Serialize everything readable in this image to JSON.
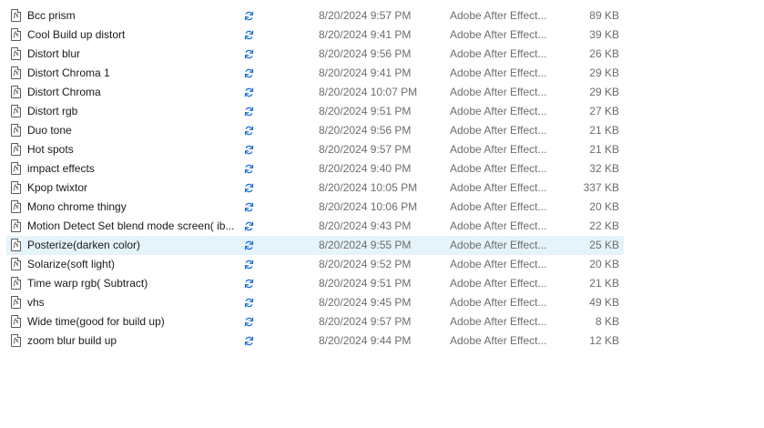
{
  "colors": {
    "selection_bg": "#e5f3fb",
    "sync_icon": "#1e6fd9",
    "meta_text": "#6d6d6d"
  },
  "icons": {
    "file_type": "fx-file-icon",
    "status": "sync-pending-icon"
  },
  "file_icon_glyph": "fx",
  "files": [
    {
      "name": "Bcc prism",
      "date": "8/20/2024 9:57 PM",
      "type": "Adobe After Effect...",
      "size": "89 KB",
      "selected": false
    },
    {
      "name": "Cool Build up distort",
      "date": "8/20/2024 9:41 PM",
      "type": "Adobe After Effect...",
      "size": "39 KB",
      "selected": false
    },
    {
      "name": "Distort blur",
      "date": "8/20/2024 9:56 PM",
      "type": "Adobe After Effect...",
      "size": "26 KB",
      "selected": false
    },
    {
      "name": "Distort Chroma 1",
      "date": "8/20/2024 9:41 PM",
      "type": "Adobe After Effect...",
      "size": "29 KB",
      "selected": false
    },
    {
      "name": "Distort Chroma",
      "date": "8/20/2024 10:07 PM",
      "type": "Adobe After Effect...",
      "size": "29 KB",
      "selected": false
    },
    {
      "name": "Distort rgb",
      "date": "8/20/2024 9:51 PM",
      "type": "Adobe After Effect...",
      "size": "27 KB",
      "selected": false
    },
    {
      "name": "Duo tone",
      "date": "8/20/2024 9:56 PM",
      "type": "Adobe After Effect...",
      "size": "21 KB",
      "selected": false
    },
    {
      "name": "Hot spots",
      "date": "8/20/2024 9:57 PM",
      "type": "Adobe After Effect...",
      "size": "21 KB",
      "selected": false
    },
    {
      "name": "impact effects",
      "date": "8/20/2024 9:40 PM",
      "type": "Adobe After Effect...",
      "size": "32 KB",
      "selected": false
    },
    {
      "name": "Kpop twixtor",
      "date": "8/20/2024 10:05 PM",
      "type": "Adobe After Effect...",
      "size": "337 KB",
      "selected": false
    },
    {
      "name": "Mono  chrome thingy",
      "date": "8/20/2024 10:06 PM",
      "type": "Adobe After Effect...",
      "size": "20 KB",
      "selected": false
    },
    {
      "name": "Motion Detect Set blend mode screen( ib...",
      "date": "8/20/2024 9:43 PM",
      "type": "Adobe After Effect...",
      "size": "22 KB",
      "selected": false
    },
    {
      "name": "Posterize(darken color)",
      "date": "8/20/2024 9:55 PM",
      "type": "Adobe After Effect...",
      "size": "25 KB",
      "selected": true
    },
    {
      "name": "Solarize(soft light)",
      "date": "8/20/2024 9:52 PM",
      "type": "Adobe After Effect...",
      "size": "20 KB",
      "selected": false
    },
    {
      "name": "Time warp rgb( Subtract)",
      "date": "8/20/2024 9:51 PM",
      "type": "Adobe After Effect...",
      "size": "21 KB",
      "selected": false
    },
    {
      "name": "vhs",
      "date": "8/20/2024 9:45 PM",
      "type": "Adobe After Effect...",
      "size": "49 KB",
      "selected": false
    },
    {
      "name": "Wide time(good  for build up)",
      "date": "8/20/2024 9:57 PM",
      "type": "Adobe After Effect...",
      "size": "8 KB",
      "selected": false
    },
    {
      "name": "zoom blur build up",
      "date": "8/20/2024 9:44 PM",
      "type": "Adobe After Effect...",
      "size": "12 KB",
      "selected": false
    }
  ]
}
